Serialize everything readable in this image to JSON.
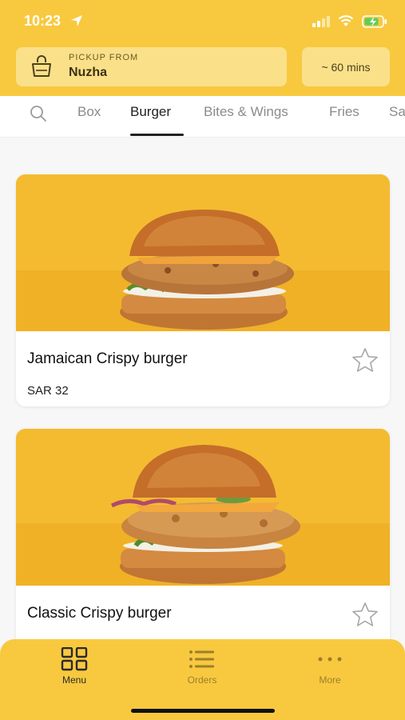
{
  "status_bar": {
    "time": "10:23"
  },
  "header": {
    "pickup_label": "PICKUP FROM",
    "pickup_location": "Nuzha",
    "eta": "~ 60 mins"
  },
  "tabs": [
    {
      "label": "Box",
      "active": false
    },
    {
      "label": "Burger",
      "active": true
    },
    {
      "label": "Bites & Wings",
      "active": false
    },
    {
      "label": "Fries",
      "active": false
    },
    {
      "label": "Sa",
      "active": false
    }
  ],
  "products": [
    {
      "name": "Jamaican Crispy burger",
      "price": "SAR 32",
      "favorite": false
    },
    {
      "name": "Classic Crispy burger",
      "favorite": false
    }
  ],
  "bottom_nav": [
    {
      "label": "Menu",
      "icon": "grid-icon",
      "active": true
    },
    {
      "label": "Orders",
      "icon": "list-icon",
      "active": false
    },
    {
      "label": "More",
      "icon": "dots-icon",
      "active": false
    }
  ],
  "colors": {
    "accent": "#f8c93f",
    "accent_light": "#fbe08a",
    "active_nav": "#2b2b2b",
    "inactive_nav": "#9c7f2a"
  }
}
